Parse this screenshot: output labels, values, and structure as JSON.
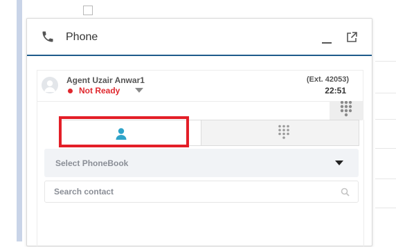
{
  "panel": {
    "title": "Phone",
    "icons": {
      "phone": "phone-icon",
      "minimize": "minimize-icon",
      "popout": "popout-icon"
    }
  },
  "agent": {
    "name": "Agent Uzair Anwar1",
    "status": "Not Ready",
    "extension": "(Ext. 42053)",
    "timer": "22:51"
  },
  "tabs": [
    {
      "id": "contacts",
      "icon": "user-icon",
      "active": true
    },
    {
      "id": "dialpad",
      "icon": "dialpad-icon",
      "active": false
    }
  ],
  "phonebook": {
    "selected": "Select PhoneBook"
  },
  "search": {
    "placeholder": "Search contact",
    "value": ""
  },
  "colors": {
    "accent": "#1d5a8a",
    "status_red": "#e0282e",
    "contact_icon": "#2fa4c9",
    "highlight": "#e31e27"
  }
}
